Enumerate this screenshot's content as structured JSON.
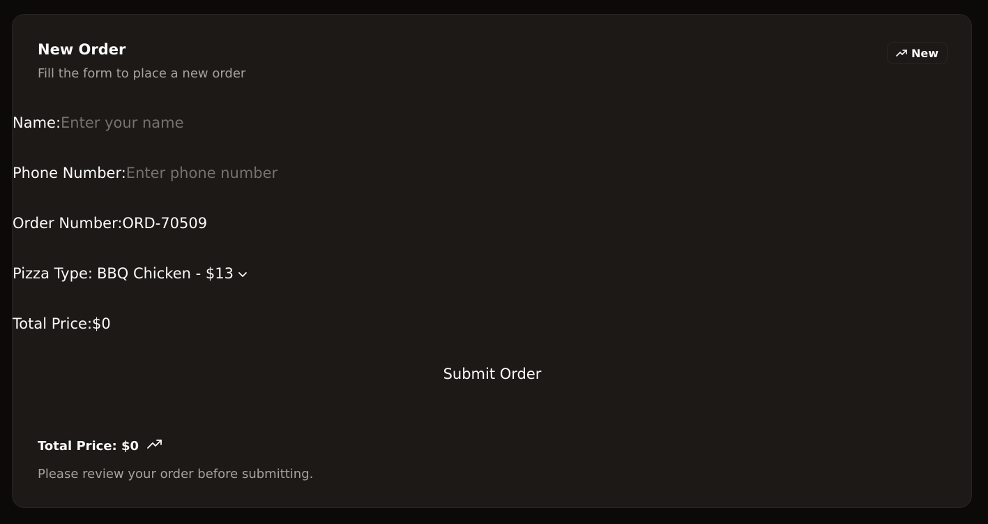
{
  "header": {
    "title": "New Order",
    "subtitle": "Fill the form to place a new order",
    "badge": {
      "label": "New",
      "icon": "trending-up-icon"
    }
  },
  "form": {
    "name": {
      "label": "Name:",
      "value": "",
      "placeholder": "Enter your name"
    },
    "phone": {
      "label": "Phone Number:",
      "value": "",
      "placeholder": "Enter phone number"
    },
    "order_number": {
      "label": "Order Number:",
      "value": "ORD-70509"
    },
    "pizza_type": {
      "label": "Pizza Type:",
      "selected": "BBQ Chicken - $13",
      "icon": "chevron-down-icon"
    },
    "total_price": {
      "label": "Total Price:",
      "value": "$0"
    },
    "submit_label": "Submit Order"
  },
  "footer": {
    "total": "Total Price: $0",
    "icon": "trending-up-icon",
    "note": "Please review your order before submitting."
  },
  "colors": {
    "page_background": "#0c0a09",
    "card_background": "#1c1917",
    "card_border": "#292524",
    "text_primary": "#fafaf9",
    "text_muted": "#a8a29e",
    "placeholder": "#78716c"
  }
}
